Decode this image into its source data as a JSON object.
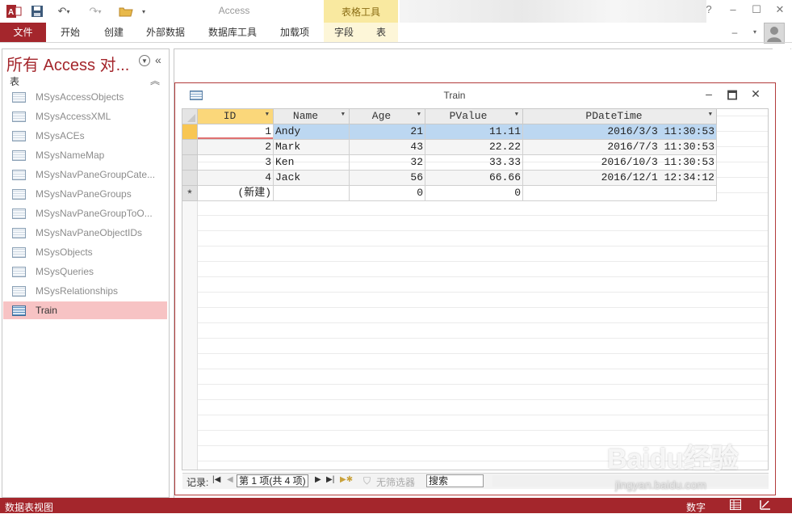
{
  "window": {
    "app_title": "Access",
    "context_title": "表格工具",
    "help_label": "?",
    "more_label": "▾"
  },
  "ribbon": {
    "file_tab": "文件",
    "tabs": [
      "开始",
      "创建",
      "外部数据",
      "数据库工具",
      "加载项"
    ],
    "context_tabs": [
      "字段",
      "表"
    ]
  },
  "nav_pane": {
    "title": "所有 Access 对...",
    "group": "表",
    "items": [
      {
        "label": "MSysAccessObjects"
      },
      {
        "label": "MSysAccessXML"
      },
      {
        "label": "MSysACEs"
      },
      {
        "label": "MSysNameMap"
      },
      {
        "label": "MSysNavPaneGroupCate..."
      },
      {
        "label": "MSysNavPaneGroups"
      },
      {
        "label": "MSysNavPaneGroupToO..."
      },
      {
        "label": "MSysNavPaneObjectIDs"
      },
      {
        "label": "MSysObjects"
      },
      {
        "label": "MSysQueries"
      },
      {
        "label": "MSysRelationships"
      },
      {
        "label": "Train"
      }
    ],
    "active_item": "Train"
  },
  "document": {
    "title": "Train"
  },
  "datasheet": {
    "columns": [
      "ID",
      "Name",
      "Age",
      "PValue",
      "PDateTime"
    ],
    "rows": [
      {
        "ID": "1",
        "Name": "Andy",
        "Age": "21",
        "PValue": "11.11",
        "PDateTime": "2016/3/3 11:30:53"
      },
      {
        "ID": "2",
        "Name": "Mark",
        "Age": "43",
        "PValue": "22.22",
        "PDateTime": "2016/7/3 11:30:53"
      },
      {
        "ID": "3",
        "Name": "Ken",
        "Age": "32",
        "PValue": "33.33",
        "PDateTime": "2016/10/3 11:30:53"
      },
      {
        "ID": "4",
        "Name": "Jack",
        "Age": "56",
        "PValue": "66.66",
        "PDateTime": "2016/12/1 12:34:12"
      }
    ],
    "new_row": {
      "marker": "*",
      "ID": "(新建)",
      "Name": "",
      "Age": "0",
      "PValue": "0",
      "PDateTime": ""
    },
    "selected_row": 1
  },
  "record_nav": {
    "label": "记录:",
    "position": "第 1 项(共 4 项)",
    "filter_label": "无筛选器",
    "search_label": "搜索"
  },
  "status_bar": {
    "view_label": "数据表视图",
    "mode_label": "数字"
  },
  "watermark": {
    "brand": "Baidu经验",
    "url": "jingyan.baidu.com"
  },
  "colors": {
    "accent": "#a4262c",
    "selected_row": "#bcd7f1",
    "current_record": "#f8c653",
    "nav_active": "#f7c3c4"
  }
}
